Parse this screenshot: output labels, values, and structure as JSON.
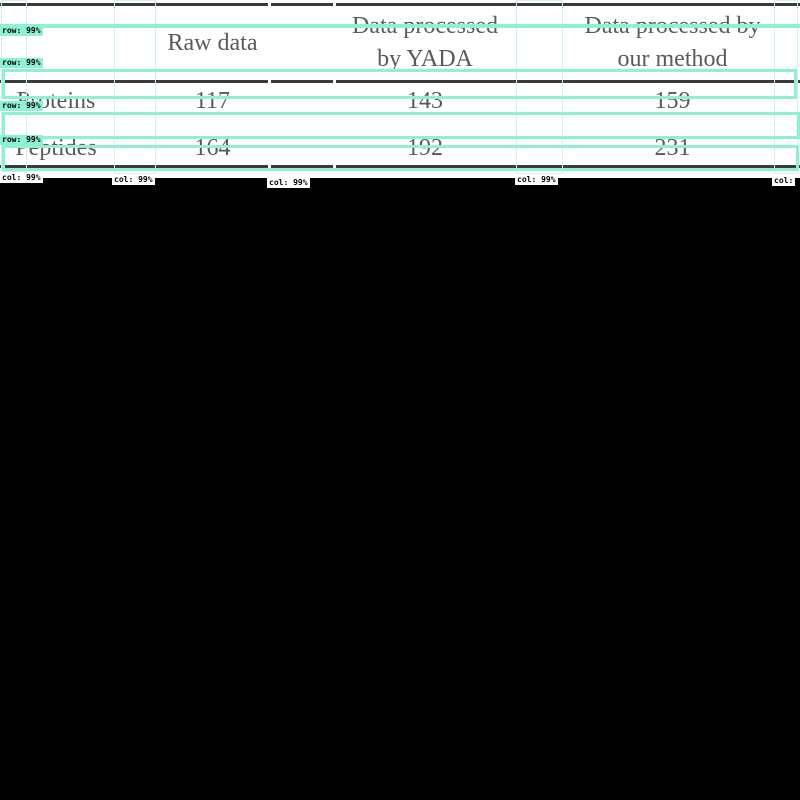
{
  "table": {
    "columns": [
      "",
      "Raw data",
      "Data processed\nby YADA",
      "Data processed by\nour method"
    ],
    "rows": [
      {
        "label": "Proteins",
        "values": [
          "117",
          "143",
          "159"
        ]
      },
      {
        "label": "Peptides",
        "values": [
          "164",
          "192",
          "231"
        ]
      }
    ]
  },
  "detections": {
    "row_labels": [
      "row: 99%",
      "row: 99%",
      "row: 99%",
      "row: 99%"
    ],
    "col_labels": [
      "col: 99%",
      "col: 99%",
      "col: 99%",
      "col: 99%",
      "col:"
    ]
  },
  "colors": {
    "background": "#000000",
    "row_box": "#8ff1d4",
    "table_text": "#5a5a5a",
    "rule": "#3a3a3a"
  }
}
